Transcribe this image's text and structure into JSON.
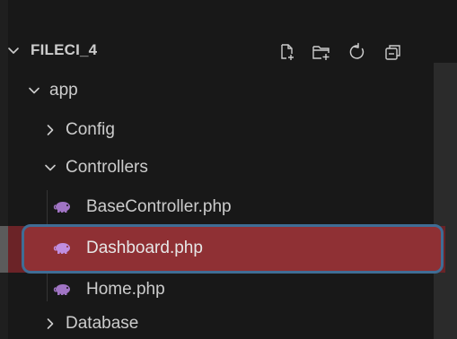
{
  "explorer": {
    "section_title": "FILECI_4",
    "actions": [
      {
        "name": "new-file-icon",
        "label": ""
      },
      {
        "name": "new-folder-icon",
        "label": ""
      },
      {
        "name": "refresh-icon",
        "label": ""
      },
      {
        "name": "collapse-all-icon",
        "label": ""
      }
    ],
    "tree": [
      {
        "label": "app",
        "type": "folder",
        "expanded": true,
        "depth": 1
      },
      {
        "label": "Config",
        "type": "folder",
        "expanded": false,
        "depth": 2
      },
      {
        "label": "Controllers",
        "type": "folder",
        "expanded": true,
        "depth": 2
      },
      {
        "label": "BaseController.php",
        "type": "file",
        "depth": 3
      },
      {
        "label": "Dashboard.php",
        "type": "file",
        "depth": 3,
        "selected": true
      },
      {
        "label": "Home.php",
        "type": "file",
        "depth": 3
      },
      {
        "label": "Database",
        "type": "folder",
        "expanded": false,
        "depth": 2
      }
    ]
  },
  "colors": {
    "background": "#181818",
    "text": "#cccccc",
    "selected_row": "#8f3034",
    "selection_outline": "#3f6d95",
    "php_icon": "#a074c4"
  }
}
